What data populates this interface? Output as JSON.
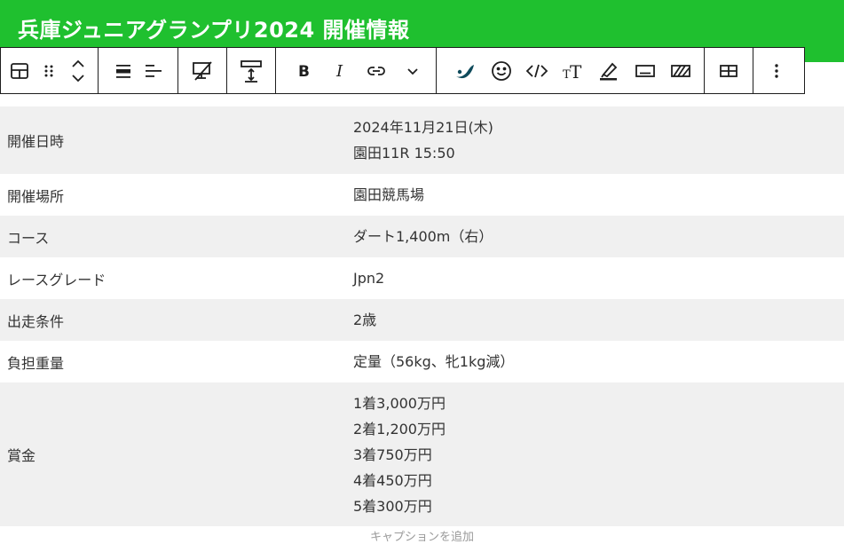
{
  "header": {
    "title": "兵庫ジュニアグランプリ2024 開催情報"
  },
  "colors": {
    "accent": "#1fc02f",
    "row_alt": "#f0f0f0",
    "text": "#333333"
  },
  "toolbar": {
    "icons": [
      "table-block-icon",
      "drag-handle-icon",
      "move-up-down-icon",
      "align-full-icon",
      "text-align-left-icon",
      "color-fill-off-icon",
      "row-height-icon",
      "bold-icon",
      "italic-icon",
      "link-icon",
      "chevron-down-icon",
      "highlight-brush-icon",
      "emoji-icon",
      "code-icon",
      "font-size-icon",
      "marker-icon",
      "keyboard-icon",
      "striped-rect-icon",
      "table-grid-icon",
      "more-options-icon"
    ]
  },
  "table": {
    "rows": [
      {
        "label": "開催日時",
        "lines": [
          "2024年11月21日(木)",
          "園田11R 15:50"
        ]
      },
      {
        "label": "開催場所",
        "lines": [
          "園田競馬場"
        ]
      },
      {
        "label": "コース",
        "lines": [
          "ダート1,400m（右）"
        ]
      },
      {
        "label": "レースグレード",
        "lines": [
          "Jpn2"
        ]
      },
      {
        "label": "出走条件",
        "lines": [
          "2歳"
        ]
      },
      {
        "label": "負担重量",
        "lines": [
          "定量（56kg、牝1kg減）"
        ]
      },
      {
        "label": "賞金",
        "lines": [
          "1着3,000万円",
          "2着1,200万円",
          "3着750万円",
          "4着450万円",
          "5着300万円"
        ]
      }
    ]
  },
  "caption": {
    "placeholder": "キャプションを追加"
  }
}
